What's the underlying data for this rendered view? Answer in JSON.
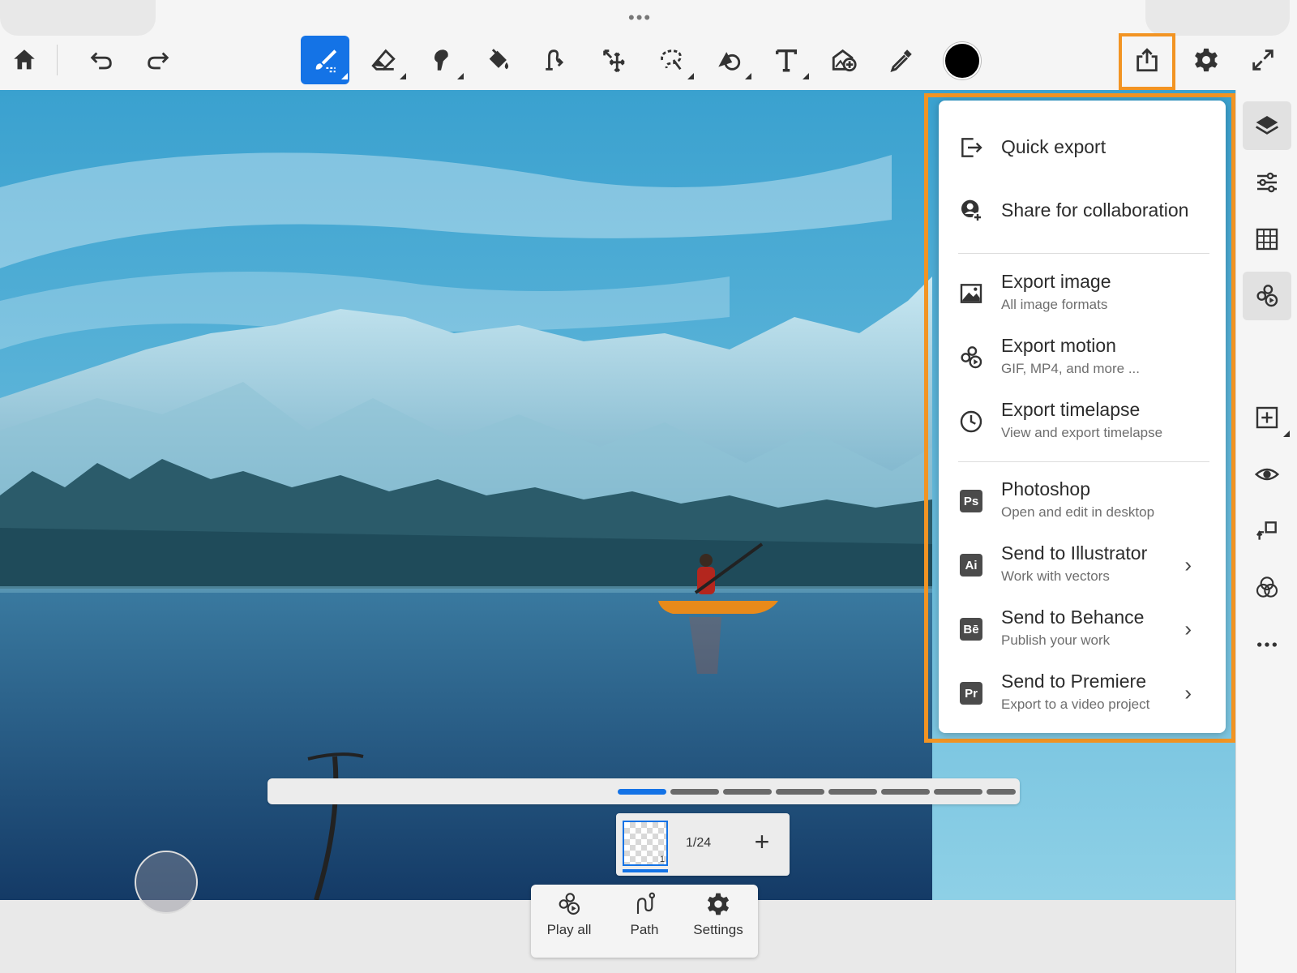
{
  "toolbar": {
    "left": [
      {
        "name": "home-icon"
      },
      {
        "name": "undo-icon"
      },
      {
        "name": "redo-icon"
      }
    ],
    "tools": [
      {
        "name": "brush-tool",
        "icon": "brush-icon",
        "active": true
      },
      {
        "name": "eraser-tool",
        "icon": "eraser-icon"
      },
      {
        "name": "smudge-tool",
        "icon": "smudge-icon"
      },
      {
        "name": "fill-tool",
        "icon": "paint-bucket-icon"
      },
      {
        "name": "liquify-tool",
        "icon": "liquify-icon"
      },
      {
        "name": "transform-tool",
        "icon": "move-icon"
      },
      {
        "name": "selection-tool",
        "icon": "lasso-icon"
      },
      {
        "name": "shape-tool",
        "icon": "shapes-icon"
      },
      {
        "name": "text-tool",
        "icon": "text-icon"
      },
      {
        "name": "image-tool",
        "icon": "add-image-icon"
      },
      {
        "name": "eyedropper-tool",
        "icon": "eyedropper-icon"
      }
    ],
    "current_color": "#000000",
    "right": [
      {
        "name": "share-icon",
        "highlighted": true
      },
      {
        "name": "gear-icon"
      },
      {
        "name": "fullscreen-icon"
      }
    ]
  },
  "export_menu": {
    "items": [
      {
        "icon": "quick-export-icon",
        "title": "Quick export",
        "subtitle": ""
      },
      {
        "icon": "share-collaboration-icon",
        "title": "Share for collaboration",
        "subtitle": ""
      },
      {
        "icon": "image-icon",
        "title": "Export image",
        "subtitle": "All image formats"
      },
      {
        "icon": "motion-icon",
        "title": "Export motion",
        "subtitle": "GIF, MP4, and more ..."
      },
      {
        "icon": "clock-icon",
        "title": "Export timelapse",
        "subtitle": "View and export timelapse"
      },
      {
        "icon": "photoshop-icon",
        "badge": "Ps",
        "title": "Photoshop",
        "subtitle": "Open and edit in desktop"
      },
      {
        "icon": "illustrator-icon",
        "badge": "Ai",
        "title": "Send to Illustrator",
        "subtitle": "Work with vectors",
        "chevron": true
      },
      {
        "icon": "behance-icon",
        "badge": "Bē",
        "title": "Send to Behance",
        "subtitle": "Publish your work",
        "chevron": true
      },
      {
        "icon": "premiere-icon",
        "badge": "Pr",
        "title": "Send to Premiere",
        "subtitle": "Export to a video project",
        "chevron": true
      }
    ]
  },
  "right_rail": [
    {
      "name": "layers-icon"
    },
    {
      "name": "adjustments-icon"
    },
    {
      "name": "grid-icon"
    },
    {
      "name": "motion-panel-icon",
      "selected": true
    },
    {
      "name": "add-layer-icon"
    },
    {
      "name": "visibility-icon"
    },
    {
      "name": "layer-actions-icon"
    },
    {
      "name": "blend-mode-icon"
    },
    {
      "name": "more-icon"
    }
  ],
  "timeline": {
    "current_frame": "1/24",
    "thumb_number": "1"
  },
  "bottom_panel": {
    "buttons": [
      {
        "name": "play-all",
        "label": "Play all",
        "icon": "motion-play-icon"
      },
      {
        "name": "path",
        "label": "Path",
        "icon": "path-icon"
      },
      {
        "name": "settings",
        "label": "Settings",
        "icon": "gear-icon"
      }
    ]
  },
  "colors": {
    "accent": "#1473e6",
    "highlight": "#f29423"
  }
}
